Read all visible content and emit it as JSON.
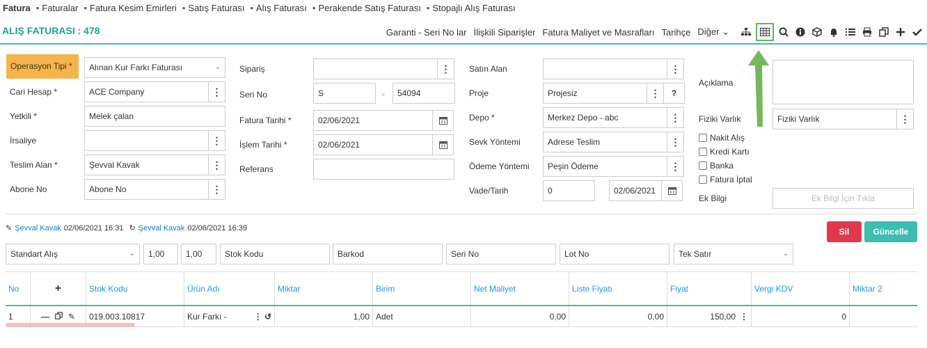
{
  "breadcrumb": [
    "Fatura",
    "Faturalar",
    "Fatura Kesim Emirleri",
    "Satış Faturası",
    "Alış Faturası",
    "Perakende Satış Faturası",
    "Stopajlı Alış Faturası"
  ],
  "page_title": "ALIŞ FATURASI : 478",
  "toolbar": {
    "links": [
      "Garanti - Seri No lar",
      "İlişkili Siparişler",
      "Fatura Maliyet ve Masrafları",
      "Tarihçe",
      "Diğer"
    ],
    "icons": [
      "sitemap-icon",
      "table-icon",
      "search-icon",
      "info-icon",
      "cube-icon",
      "bell-icon",
      "list-icon",
      "print-icon",
      "copy-icon",
      "plus-icon",
      "check-icon"
    ],
    "highlight_color": "#5cb85c"
  },
  "col1": {
    "operasyon_label": "Operasyon Tipi *",
    "operasyon_value": "Alınan Kur Farkı Faturası",
    "cari_label": "Cari Hesap *",
    "cari_value": "ACE Company",
    "yetkili_label": "Yetkili *",
    "yetkili_value": "Melek çalan",
    "irsaliye_label": "İrsaliye",
    "teslim_label": "Teslim Alan *",
    "teslim_value": "Şevval Kavak",
    "abone_label": "Abone No",
    "abone_placeholder": "Abone No"
  },
  "col2": {
    "siparis_label": "Sipariş",
    "seri_label": "Seri No",
    "seri_value": "S",
    "seri_dash": "-",
    "seri_number": "54094",
    "fatura_tarihi_label": "Fatura Tarihi *",
    "fatura_tarihi_value": "02/06/2021",
    "islem_tarihi_label": "İşlem Tarihi *",
    "islem_tarihi_value": "02/06/2021",
    "referans_label": "Referans"
  },
  "col3": {
    "satin_alan_label": "Satın Alan",
    "proje_label": "Proje",
    "proje_value": "Projesiz",
    "depo_label": "Depo *",
    "depo_value": "Merkez Depo - abc",
    "sevk_label": "Sevk Yöntemi",
    "sevk_value": "Adrese Teslim",
    "odeme_label": "Ödeme Yöntemi",
    "odeme_value": "Peşin Ödeme",
    "vade_label": "Vade/Tarih",
    "vade_value": "0",
    "vade_date": "02/06/2021"
  },
  "col4": {
    "aciklama_label": "Açıklama",
    "fiziki_label": "Fiziki Varlık",
    "fiziki_placeholder": "Fiziki Varlık",
    "checkboxes": [
      "Nakit Alış",
      "Kredi Kartı",
      "Banka",
      "Fatura İptal"
    ],
    "ek_bilgi_label": "Ek Bilgi",
    "ek_bilgi_button": "Ek Bilgi İçin Tıkla"
  },
  "audit": {
    "created_user": "Şevval Kavak",
    "created_at": "02/06/2021 16:31",
    "updated_user": "Şevval Kavak",
    "updated_at": "02/06/2021 16:39"
  },
  "buttons": {
    "delete": "Sil",
    "update": "Güncelle"
  },
  "line_entry": {
    "type": "Standart Alış",
    "qty": "1,00",
    "rate": "1,00",
    "stok_placeholder": "Stok Kodu",
    "barkod_placeholder": "Barkod",
    "seri_placeholder": "Seri No",
    "lot_placeholder": "Lot No",
    "mode": "Tek Satır"
  },
  "table": {
    "headers": [
      "No",
      "+",
      "Stok Kodu",
      "Ürün Adı",
      "Miktar",
      "Birim",
      "Net Maliyet",
      "Liste Fiyatı",
      "Fiyat",
      "Vergi KDV",
      "Miktar 2"
    ],
    "row": {
      "no": "1",
      "stok_kodu": "019.003.10817",
      "urun_adi": "Kur Farkı -",
      "miktar": "1,00",
      "birim": "Adet",
      "net_maliyet": "0,00",
      "liste_fiyati": "0,00",
      "fiyat": "150,00",
      "vergi_kdv": "0"
    }
  }
}
